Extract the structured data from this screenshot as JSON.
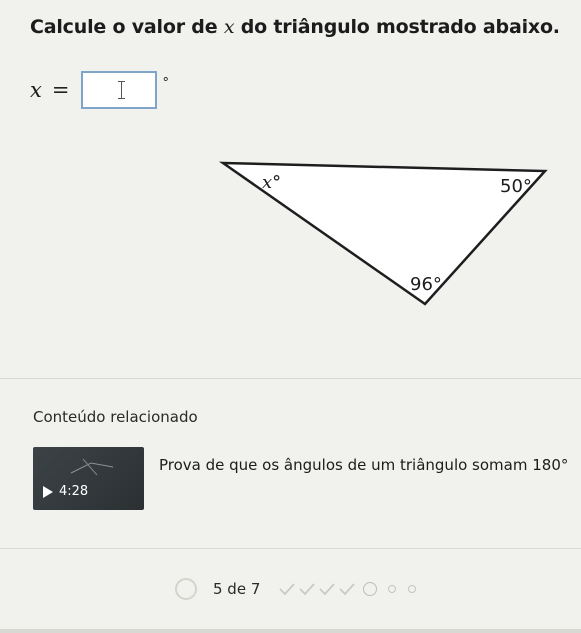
{
  "question": {
    "title_before": "Calcule o valor de ",
    "title_var": "x",
    "title_after": " do triângulo mostrado abaixo."
  },
  "answer": {
    "variable": "x",
    "equals": "=",
    "value": "",
    "unit": "°"
  },
  "triangle": {
    "angle_top_left": "x°",
    "angle_right": "50°",
    "angle_bottom": "96°"
  },
  "related": {
    "heading": "Conteúdo relacionado",
    "video": {
      "duration": "4:28",
      "title": "Prova de que os ângulos de um triângulo somam 180°"
    }
  },
  "progress": {
    "label": "5 de 7",
    "completed": 4,
    "total": 7
  }
}
